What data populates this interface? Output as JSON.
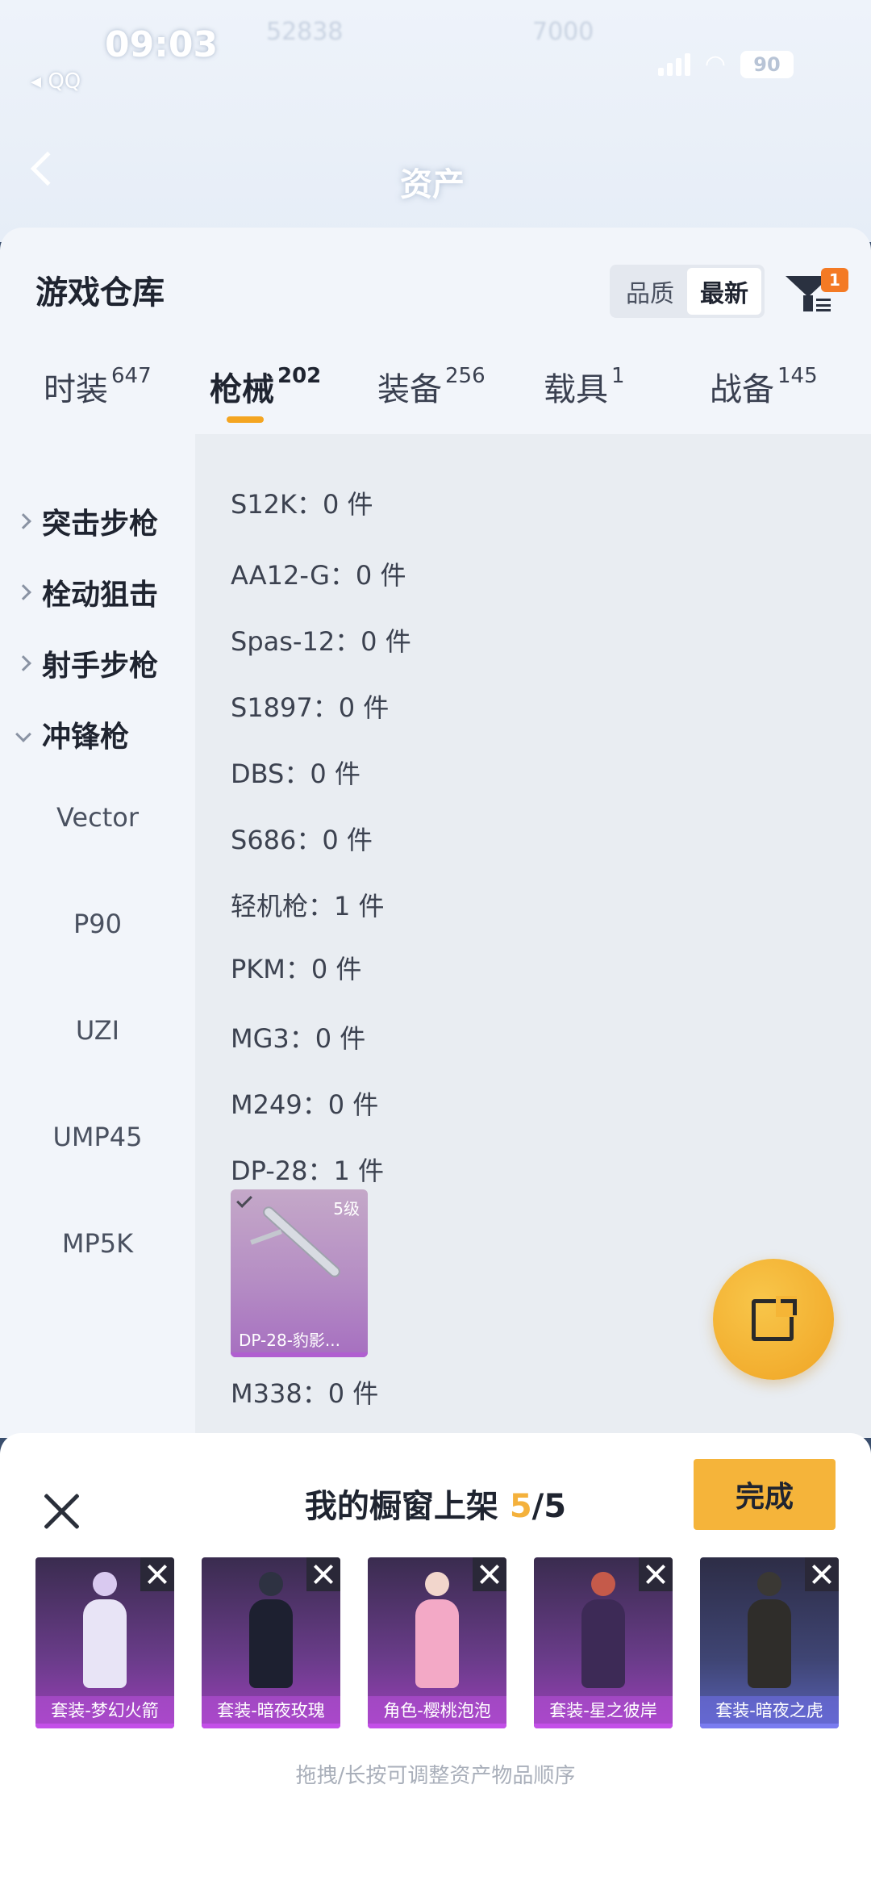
{
  "status": {
    "time": "09:03",
    "back_app": "◂ QQ",
    "battery": "90"
  },
  "background": {
    "title": "资产",
    "ghost_numbers": [
      "52838",
      "7000"
    ]
  },
  "sheet": {
    "title": "游戏仓库",
    "sort_options": [
      "品质",
      "最新"
    ],
    "sort_selected": "最新",
    "filter_badge": "1"
  },
  "tabs": [
    {
      "label": "时装",
      "count": "647"
    },
    {
      "label": "枪械",
      "count": "202",
      "active": true
    },
    {
      "label": "装备",
      "count": "256"
    },
    {
      "label": "载具",
      "count": "1"
    },
    {
      "label": "战备",
      "count": "145"
    }
  ],
  "sidebar": {
    "categories": [
      "突击步枪",
      "栓动狙击",
      "射手步枪",
      "冲锋枪"
    ],
    "expanded": "冲锋枪",
    "subitems": [
      "Vector",
      "P90",
      "UZI",
      "UMP45",
      "MP5K"
    ]
  },
  "content": {
    "rows": [
      "S12K：0 件",
      "AA12-G：0 件",
      "Spas-12：0 件",
      "S1897：0 件",
      "DBS：0 件",
      "S686：0 件",
      "轻机枪：1 件",
      "PKM：0 件",
      "MG3：0 件",
      "M249：0 件",
      "DP-28：1 件",
      "M338：0 件"
    ],
    "item_card": {
      "level": "5级",
      "name": "DP-28-豹影..."
    }
  },
  "shelf": {
    "title_prefix": "我的橱窗上架 ",
    "count_current": "5",
    "count_total": "/5",
    "done_label": "完成",
    "items": [
      {
        "label": "套装-梦幻火箭"
      },
      {
        "label": "套装-暗夜玫瑰"
      },
      {
        "label": "角色-樱桃泡泡"
      },
      {
        "label": "套装-星之彼岸"
      },
      {
        "label": "套装-暗夜之虎"
      }
    ],
    "hint": "拖拽/长按可调整资产物品顺序"
  },
  "colors": {
    "accent": "#f4a521",
    "badge": "#f47a24",
    "purple_rarity": "#b05fd0",
    "blue_rarity": "#7a7cf0"
  }
}
